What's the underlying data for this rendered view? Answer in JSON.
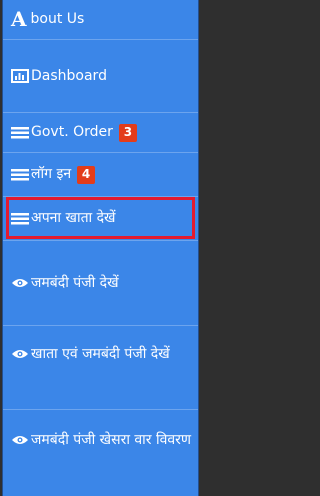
{
  "menu": {
    "items": [
      {
        "first_letter": "A",
        "label": "bout Us",
        "icon": "none"
      },
      {
        "label": "Dashboard",
        "icon": "bar-chart-icon"
      },
      {
        "label": "Govt. Order",
        "icon": "list-icon",
        "badge": "3"
      },
      {
        "label": "लॉग इन",
        "icon": "list-icon",
        "badge": "4"
      },
      {
        "label": "अपना खाता देखें",
        "icon": "list-icon",
        "active": true
      },
      {
        "label": "जमबंदी पंजी देखें",
        "icon": "eye-icon"
      },
      {
        "label": "खाता एवं जमबंदी पंजी देखें",
        "icon": "eye-icon"
      },
      {
        "label": "जमबंदी पंजी खेसरा वार विवरण",
        "icon": "eye-icon"
      }
    ]
  },
  "colors": {
    "menu_bg": "#3b86e8",
    "badge_bg": "#e33c1a",
    "active_outline": "#e31b2f",
    "text": "#ffffff"
  }
}
